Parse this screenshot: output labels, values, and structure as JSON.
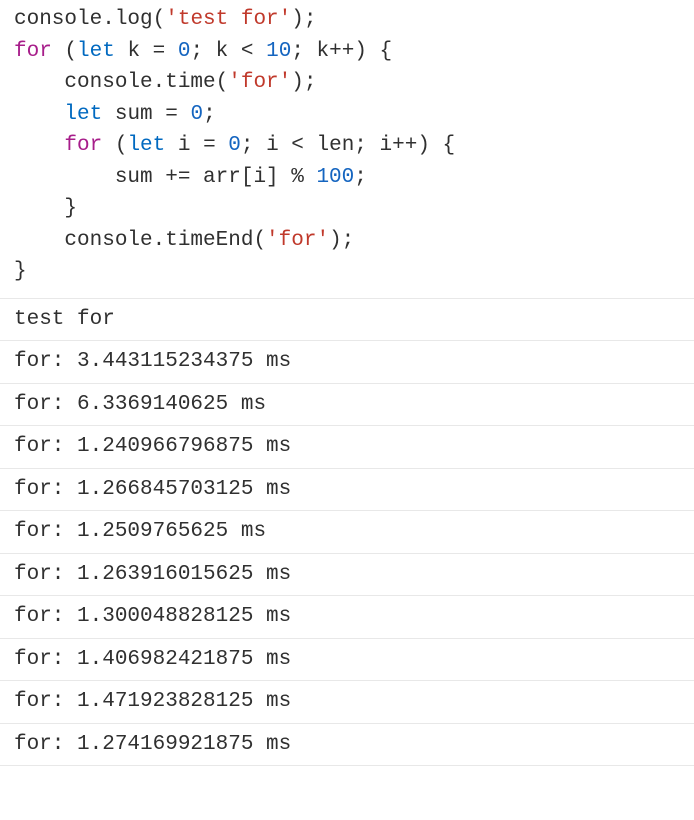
{
  "code": {
    "t1": "console.log(",
    "s1": "'test for'",
    "t2": ");",
    "kw_for1": "for",
    "t3": " (",
    "kw_let1": "let",
    "t4": " k = ",
    "n0a": "0",
    "t5": "; k < ",
    "n10": "10",
    "t6": "; k++) {",
    "t7": "    console.time(",
    "s2": "'for'",
    "t8": ");",
    "t9": "    ",
    "kw_let2": "let",
    "t10": " sum = ",
    "n0b": "0",
    "t11": ";",
    "t12": "    ",
    "kw_for2": "for",
    "t13": " (",
    "kw_let3": "let",
    "t14": " i = ",
    "n0c": "0",
    "t15": "; i < len; i++) {",
    "t16": "        sum += arr[i] % ",
    "n100": "100",
    "t17": ";",
    "t18": "    }",
    "t19": "    console.timeEnd(",
    "s3": "'for'",
    "t20": ");",
    "t21": "}"
  },
  "output": {
    "header": "test for",
    "lines": [
      "for: 3.443115234375 ms",
      "for: 6.3369140625 ms",
      "for: 1.240966796875 ms",
      "for: 1.266845703125 ms",
      "for: 1.2509765625 ms",
      "for: 1.263916015625 ms",
      "for: 1.300048828125 ms",
      "for: 1.406982421875 ms",
      "for: 1.471923828125 ms",
      "for: 1.274169921875 ms"
    ]
  }
}
